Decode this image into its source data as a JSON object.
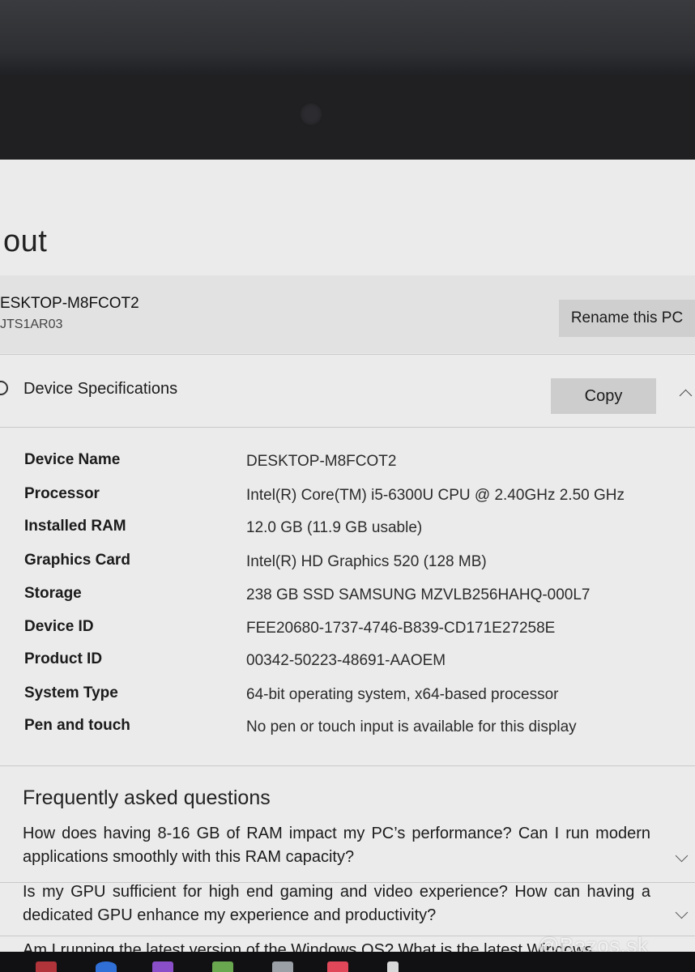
{
  "window": {
    "title": "out"
  },
  "pc": {
    "name": "ESKTOP-M8FCOT2",
    "model": "JTS1AR03",
    "rename_label": "Rename this PC"
  },
  "device_specifications": {
    "title": "Device Specifications",
    "copy_label": "Copy",
    "rows": [
      {
        "label": "Device Name",
        "value": "DESKTOP-M8FCOT2"
      },
      {
        "label": "Processor",
        "value": "Intel(R) Core(TM) i5-6300U CPU @ 2.40GHz   2.50 GHz"
      },
      {
        "label": "Installed RAM",
        "value": "12.0 GB (11.9 GB usable)"
      },
      {
        "label": "Graphics Card",
        "value": "Intel(R) HD Graphics 520 (128 MB)"
      },
      {
        "label": "Storage",
        "value": "238 GB SSD SAMSUNG MZVLB256HAHQ-000L7"
      },
      {
        "label": "Device ID",
        "value": "FEE20680-1737-4746-B839-CD171E27258E"
      },
      {
        "label": "Product ID",
        "value": "00342-50223-48691-AAOEM"
      },
      {
        "label": "System Type",
        "value": "64-bit operating system, x64-based processor"
      },
      {
        "label": "Pen and touch",
        "value": "No pen or touch input is available for this display"
      }
    ]
  },
  "faq": {
    "title": "Frequently asked questions",
    "items": [
      {
        "question": "How does having 8-16 GB of RAM impact my PC’s performance? Can I run modern applications smoothly with this RAM capacity?"
      },
      {
        "question": "Is my GPU sufficient for high end gaming and video experience? How can having a dedicated GPU enhance my experience and productivity?"
      },
      {
        "question": "Am I running the latest version of the Windows OS? What is the latest Windows"
      }
    ]
  },
  "watermark": "@Bazos.sk",
  "colors": {
    "screen_bg": "#ebebeb",
    "button_bg": "#cdcdcd",
    "bezel": "#202023"
  }
}
